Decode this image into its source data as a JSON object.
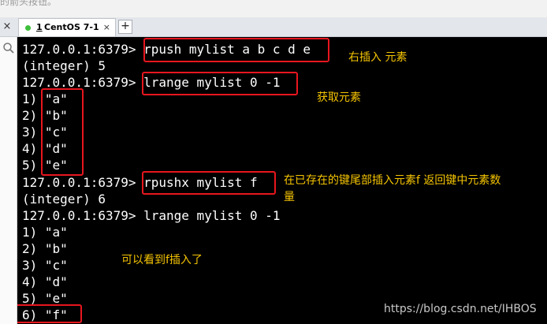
{
  "top_strip_text": "的箭头按钮。",
  "tab": {
    "number": "1",
    "name": "CentOS 7-1",
    "close": "×",
    "status_color": "#3dbf3a"
  },
  "add_tab": "+",
  "window_close": "×",
  "terminal_lines": [
    "127.0.0.1:6379> rpush mylist a b c d e",
    "(integer) 5",
    "127.0.0.1:6379> lrange mylist 0 -1",
    "1) \"a\"",
    "2) \"b\"",
    "3) \"c\"",
    "4) \"d\"",
    "5) \"e\"",
    "127.0.0.1:6379> rpushx mylist f",
    "(integer) 6",
    "127.0.0.1:6379> lrange mylist 0 -1",
    "1) \"a\"",
    "2) \"b\"",
    "3) \"c\"",
    "4) \"d\"",
    "5) \"e\"",
    "6) \"f\""
  ],
  "annotations": {
    "rpush": "右插入 元素",
    "lrange": "获取元素",
    "rpushx_line1": "在已存在的键尾部插入元素f  返回键中元素数",
    "rpushx_line2": "量",
    "result": "可以看到f插入了"
  },
  "watermark": "https://blog.csdn.net/IHBOS",
  "colors": {
    "annotation": "#f5c400",
    "highlight_box": "#e8161e",
    "terminal_bg": "#000000",
    "terminal_fg": "#ffffff"
  }
}
